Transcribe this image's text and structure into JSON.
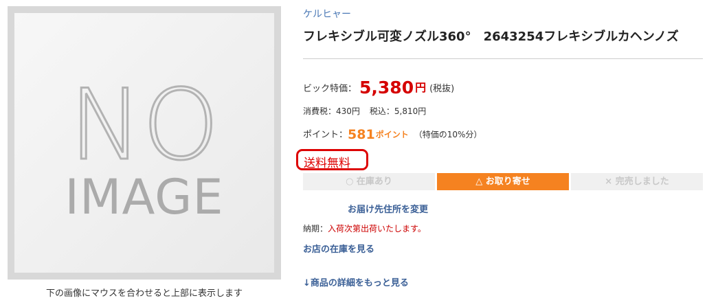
{
  "product_image": {
    "placeholder_line1": "NO",
    "placeholder_line2": "IMAGE",
    "caption": "下の画像にマウスを合わせると上部に表示します"
  },
  "maker": "ケルヒャー",
  "title": "フレキシブル可変ノズル360°　2643254フレキシブルカヘンノズ",
  "price": {
    "label": "ビック特価：",
    "value": "5,380",
    "unit": "円",
    "tax_note": "(税抜)"
  },
  "tax": {
    "consumption": "消費税：430円",
    "included": "税込：5,810円"
  },
  "points": {
    "label": "ポイント：",
    "value": "581",
    "unit": "ポイント",
    "note": "（特価の10%分）"
  },
  "free_shipping": "送料無料",
  "stock_status": {
    "in_stock": "○ 在庫あり",
    "order": "△ お取り寄せ",
    "sold_out": "× 完売しました"
  },
  "links": {
    "change_address": "お届け先住所を変更",
    "store_stock": "お店の在庫を見る",
    "more_detail": "↓商品の詳細をもっと見る"
  },
  "delivery": {
    "label": "納期：",
    "value": "入荷次第出荷いたします。"
  },
  "colors": {
    "price_red": "#d50000",
    "point_orange": "#f58220",
    "link_blue": "#3a5f96",
    "maker_blue": "#4a78b5",
    "free_ship_red": "#dd0000"
  }
}
